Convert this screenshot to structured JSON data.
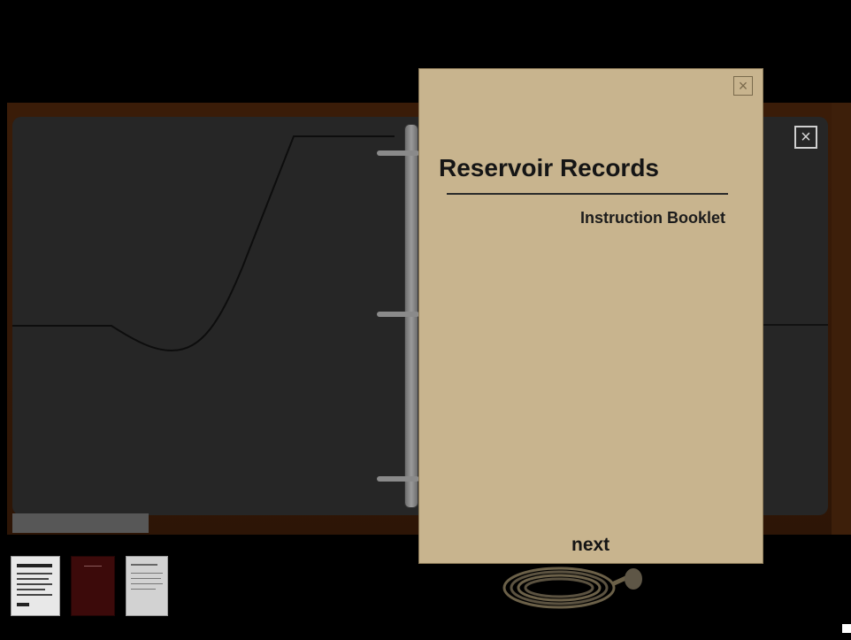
{
  "booklet": {
    "title": "Reservoir Records",
    "subtitle": "Instruction Booklet",
    "next_label": "next",
    "close_icon": "close-box-icon"
  },
  "binder": {
    "close_icon": "close-box-icon"
  },
  "inventory": {
    "items": [
      "document-icon",
      "red-book-icon",
      "note-card-icon"
    ]
  },
  "colors": {
    "booklet_paper": "#c8b48e",
    "binder": "#262626",
    "desk": "#3a1c08",
    "background": "#000000"
  }
}
